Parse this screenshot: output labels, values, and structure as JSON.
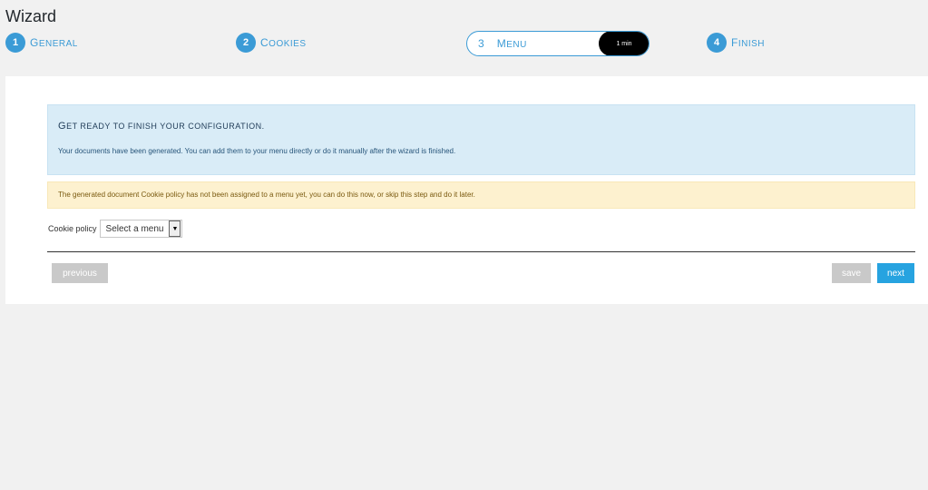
{
  "header": {
    "title": "Wizard"
  },
  "steps": [
    {
      "number": "1",
      "label": "General"
    },
    {
      "number": "2",
      "label": "Cookies"
    },
    {
      "number": "3",
      "label": "Menu",
      "time": "1 min"
    },
    {
      "number": "4",
      "label": "Finish"
    }
  ],
  "info": {
    "heading": "Get ready to finish your configuration.",
    "text": "Your documents have been generated. You can add them to your menu directly or do it manually after the wizard is finished."
  },
  "warning": {
    "text": "The generated document Cookie policy has not been assigned to a menu yet, you can do this now, or skip this step and do it later."
  },
  "field": {
    "label": "Cookie policy",
    "select_value": "Select a menu"
  },
  "buttons": {
    "previous": "previous",
    "save": "save",
    "next": "next"
  },
  "colors": {
    "accent": "#3b9bd6",
    "primary_button": "#27a3e0",
    "disabled_button": "#c9c9c9",
    "info_bg": "#d9ecf7",
    "warning_bg": "#fdf1cf"
  }
}
